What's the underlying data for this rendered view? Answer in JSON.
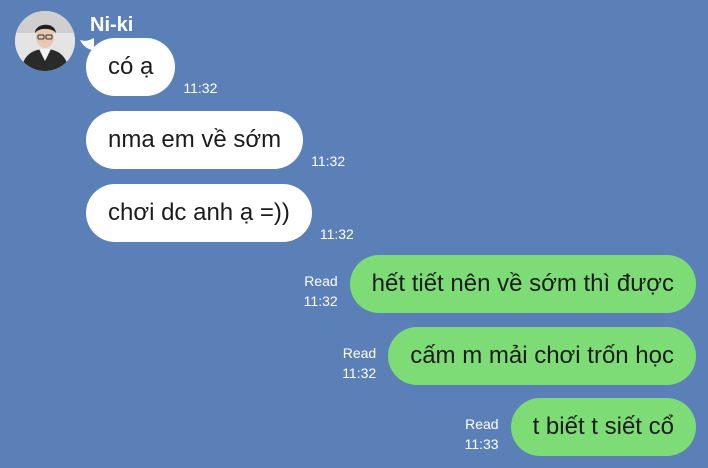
{
  "contact": {
    "name": "Ni-ki"
  },
  "messages": [
    {
      "text": "có ạ",
      "time": "11:32"
    },
    {
      "text": "nma em về sớm",
      "time": "11:32"
    },
    {
      "text": "chơi dc anh ạ =))",
      "time": "11:32"
    },
    {
      "text": "hết tiết nên về sớm thì được",
      "time": "11:32",
      "status": "Read"
    },
    {
      "text": "cấm m mải chơi trốn học",
      "time": "11:32",
      "status": "Read"
    },
    {
      "text": "t biết t siết cổ",
      "time": "11:33",
      "status": "Read"
    }
  ],
  "colors": {
    "background": "#5b80b7",
    "incoming_bubble": "#ffffff",
    "outgoing_bubble": "#7ddc75"
  },
  "icons": {
    "avatar": "contact-avatar-photo"
  }
}
